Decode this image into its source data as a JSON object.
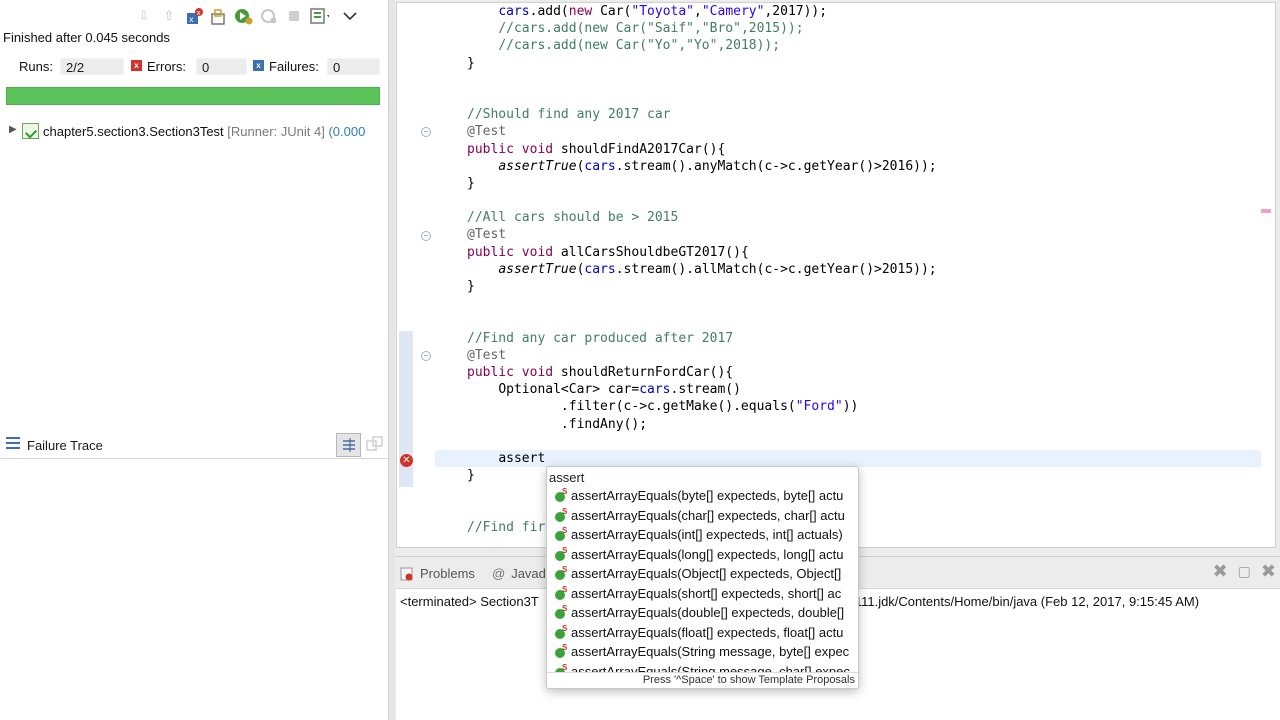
{
  "junit": {
    "status": "Finished after 0.045 seconds",
    "runs_label": "Runs:",
    "runs_value": "2/2",
    "errors_label": "Errors:",
    "errors_value": "0",
    "failures_label": "Failures:",
    "failures_value": "0",
    "progress": 1.0,
    "progress_color": "#5dc35b",
    "tree_item_name": "chapter5.section3.Section3Test",
    "tree_item_runner": " [Runner: JUnit 4]",
    "tree_item_time": " (0.000",
    "failure_trace_title": "Failure Trace"
  },
  "editor": {
    "lines": [
      {
        "indent": "    ",
        "parts": [
          [
            "fld",
            "cars"
          ],
          [
            "",
            "."
          ],
          [
            "",
            "add("
          ],
          [
            "kw",
            "new"
          ],
          [
            "",
            " Car("
          ],
          [
            "str",
            "\"Toyota\""
          ],
          [
            "",
            ","
          ],
          [
            "str",
            "\"Camery\""
          ],
          [
            "",
            ",2017));"
          ]
        ]
      },
      {
        "indent": "    ",
        "parts": [
          [
            "cm",
            "//cars.add(new Car(\"Saif\",\"Bro\",2015));"
          ]
        ]
      },
      {
        "indent": "    ",
        "parts": [
          [
            "cm",
            "//cars.add(new Car(\"Yo\",\"Yo\",2018));"
          ]
        ]
      },
      {
        "indent": "",
        "parts": [
          [
            "",
            "}"
          ]
        ]
      },
      {
        "indent": "",
        "parts": [
          [
            "",
            ""
          ]
        ]
      },
      {
        "indent": "",
        "parts": [
          [
            "",
            ""
          ]
        ]
      },
      {
        "indent": "",
        "parts": [
          [
            "cm",
            "//Should find any 2017 car"
          ]
        ]
      },
      {
        "indent": "",
        "parts": [
          [
            "ann",
            "@Test"
          ]
        ]
      },
      {
        "indent": "",
        "parts": [
          [
            "kw",
            "public"
          ],
          [
            "",
            " "
          ],
          [
            "kw",
            "void"
          ],
          [
            "",
            " shouldFindA2017Car(){"
          ]
        ]
      },
      {
        "indent": "    ",
        "parts": [
          [
            "it",
            "assertTrue"
          ],
          [
            "",
            "("
          ],
          [
            "fld",
            "cars"
          ],
          [
            "",
            ".stream().anyMatch(c->c.getYear()>2016));"
          ]
        ]
      },
      {
        "indent": "",
        "parts": [
          [
            "",
            "}"
          ]
        ]
      },
      {
        "indent": "",
        "parts": [
          [
            "",
            ""
          ]
        ]
      },
      {
        "indent": "",
        "parts": [
          [
            "cm",
            "//All cars should be > 2015"
          ]
        ]
      },
      {
        "indent": "",
        "parts": [
          [
            "ann",
            "@Test"
          ]
        ]
      },
      {
        "indent": "",
        "parts": [
          [
            "kw",
            "public"
          ],
          [
            "",
            " "
          ],
          [
            "kw",
            "void"
          ],
          [
            "",
            " allCarsShouldbeGT2017(){"
          ]
        ]
      },
      {
        "indent": "    ",
        "parts": [
          [
            "it",
            "assertTrue"
          ],
          [
            "",
            "("
          ],
          [
            "fld",
            "cars"
          ],
          [
            "",
            ".stream().allMatch(c->c.getYear()>2015));"
          ]
        ]
      },
      {
        "indent": "",
        "parts": [
          [
            "",
            "}"
          ]
        ]
      },
      {
        "indent": "",
        "parts": [
          [
            "",
            ""
          ]
        ]
      },
      {
        "indent": "",
        "parts": [
          [
            "",
            ""
          ]
        ]
      },
      {
        "indent": "",
        "parts": [
          [
            "cm",
            "//Find any car produced after 2017"
          ]
        ]
      },
      {
        "indent": "",
        "parts": [
          [
            "ann",
            "@Test"
          ]
        ]
      },
      {
        "indent": "",
        "parts": [
          [
            "kw",
            "public"
          ],
          [
            "",
            " "
          ],
          [
            "kw",
            "void"
          ],
          [
            "",
            " shouldReturnFordCar(){"
          ]
        ]
      },
      {
        "indent": "    ",
        "parts": [
          [
            "",
            "Optional<Car> car="
          ],
          [
            "fld",
            "cars"
          ],
          [
            "",
            ".stream()"
          ]
        ]
      },
      {
        "indent": "            ",
        "parts": [
          [
            "",
            ".filter(c->c.getMake().equals("
          ],
          [
            "str",
            "\"Ford\""
          ],
          [
            "",
            "))"
          ]
        ]
      },
      {
        "indent": "            ",
        "parts": [
          [
            "",
            ".findAny();"
          ]
        ]
      },
      {
        "indent": "",
        "parts": [
          [
            "",
            ""
          ]
        ]
      },
      {
        "indent": "    ",
        "parts": [
          [
            "",
            "assert"
          ]
        ]
      },
      {
        "indent": "",
        "parts": [
          [
            "",
            "}"
          ]
        ]
      },
      {
        "indent": "",
        "parts": [
          [
            "",
            ""
          ]
        ]
      },
      {
        "indent": "",
        "parts": [
          [
            "",
            ""
          ]
        ]
      },
      {
        "indent": "",
        "parts": [
          [
            "cm",
            "//Find fir"
          ]
        ]
      }
    ]
  },
  "console": {
    "tab_problems": "Problems",
    "tab_javadoc": "Javad",
    "text_left": "<terminated> Section3T",
    "text_right": ".0_111.jdk/Contents/Home/bin/java (Feb 12, 2017, 9:15:45 AM)"
  },
  "assist": {
    "filter_text": "assert",
    "proposals": [
      "assertArrayEquals(byte[] expecteds, byte[] actu",
      "assertArrayEquals(char[] expecteds, char[] actu",
      "assertArrayEquals(int[] expecteds, int[] actuals)",
      "assertArrayEquals(long[] expecteds, long[] actu",
      "assertArrayEquals(Object[] expecteds, Object[]",
      "assertArrayEquals(short[] expecteds, short[] ac",
      "assertArrayEquals(double[] expecteds, double[]",
      "assertArrayEquals(float[] expecteds, float[] actu",
      "assertArrayEquals(String message, byte[] expec",
      "assertArrayEquals(String message, char[] expec"
    ],
    "hint": "Press '^Space' to show Template Proposals"
  },
  "colors": {
    "keyword": "#7f0055",
    "comment": "#3f7f5f",
    "string": "#2a00ff",
    "field": "#0000c0",
    "success_bar": "#5dc35b",
    "error": "#d3322b"
  }
}
